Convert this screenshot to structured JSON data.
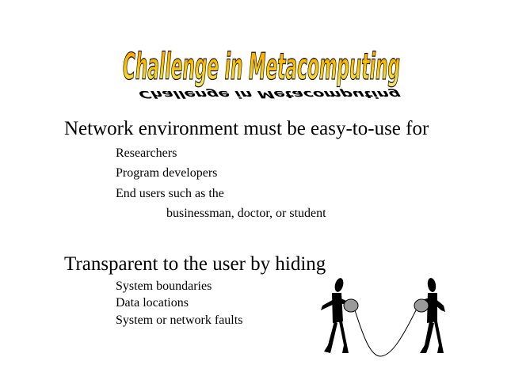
{
  "title": "Challenge in Metacomputing",
  "sections": [
    {
      "heading": "Network environment must be easy-to-use for",
      "items": [
        "Researchers",
        "Program developers",
        "End users such as the"
      ],
      "continuation": "businessman, doctor, or student"
    },
    {
      "heading": "Transparent to the user by hiding",
      "items": [
        "System boundaries",
        "Data locations",
        "System or network faults"
      ]
    }
  ],
  "colors": {
    "title_gradient_top": "#ff9f00",
    "title_gradient_mid": "#f6c200",
    "title_gradient_bottom": "#f4ee7a",
    "title_outline": "#1a0f00",
    "figure_fill": "#000000",
    "cup_fill": "#9a9a9a"
  },
  "illustration": "two-people-tin-can-telephone-icon"
}
